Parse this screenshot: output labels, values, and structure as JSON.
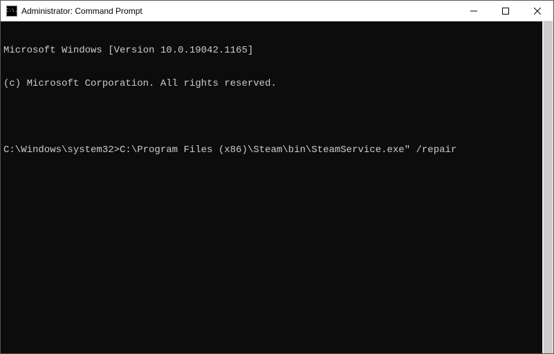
{
  "titlebar": {
    "title": "Administrator: Command Prompt",
    "icon_text": "C:\\."
  },
  "terminal": {
    "lines": [
      "Microsoft Windows [Version 10.0.19042.1165]",
      "(c) Microsoft Corporation. All rights reserved.",
      "",
      "C:\\Windows\\system32>C:\\Program Files (x86)\\Steam\\bin\\SteamService.exe\" /repair"
    ]
  }
}
